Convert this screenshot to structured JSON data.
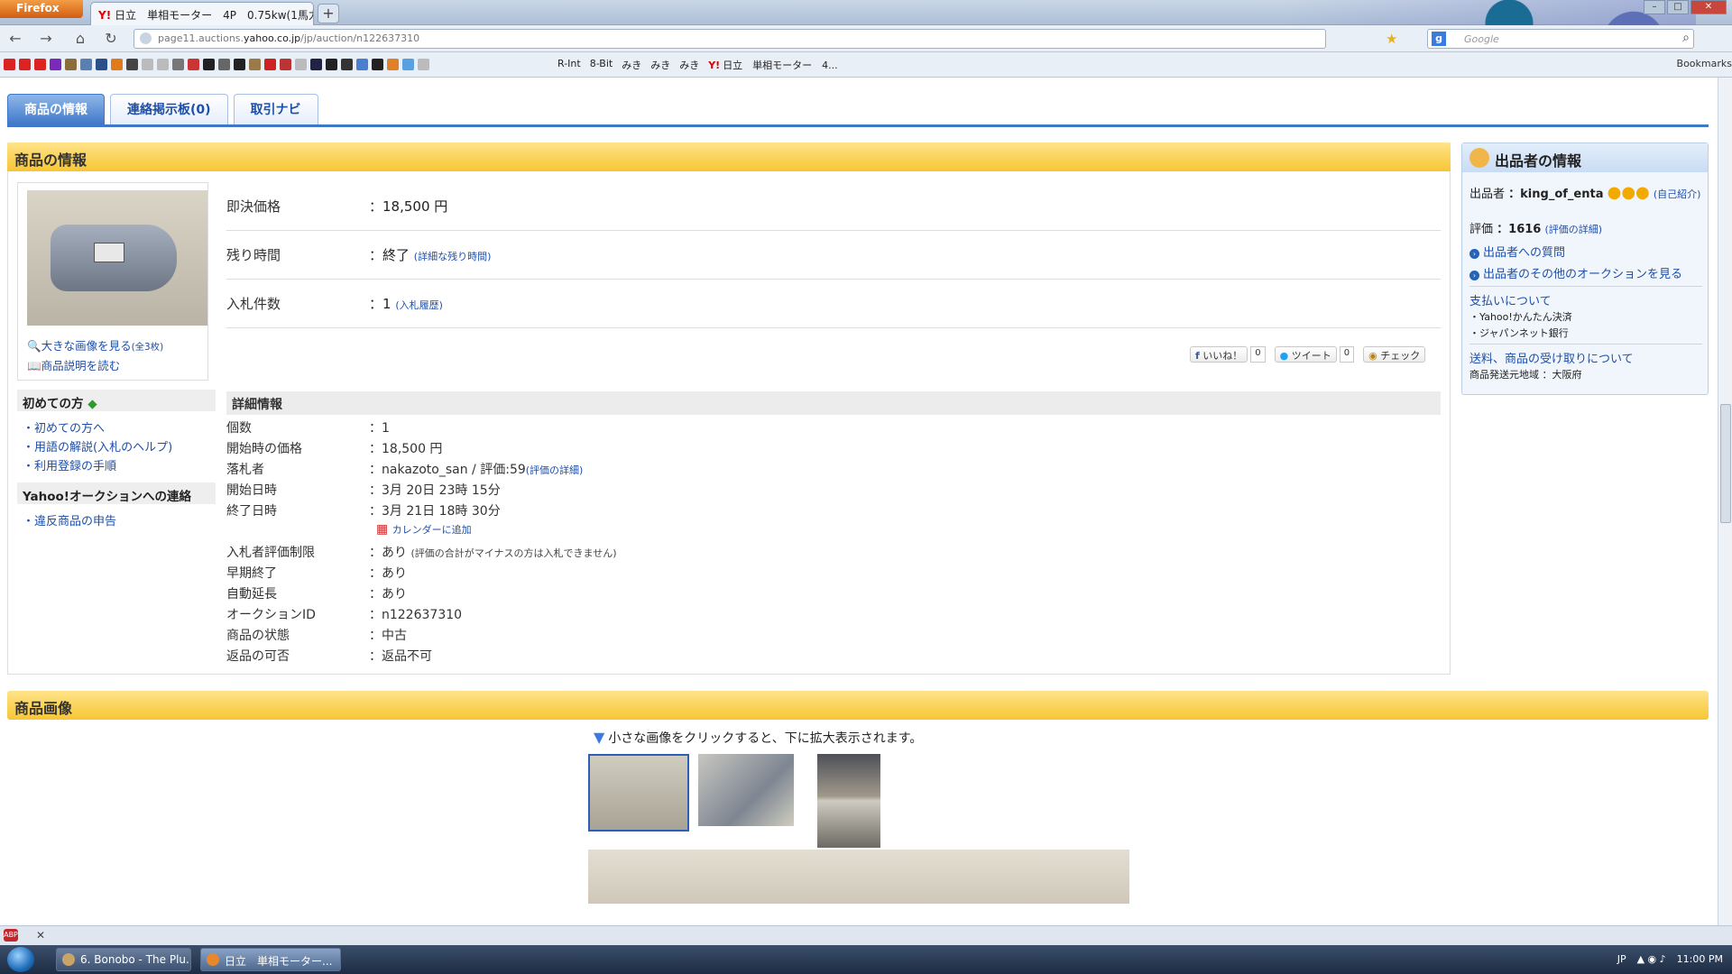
{
  "browser": {
    "menu_label": "Firefox",
    "tab_title": "日立　単相モーター　4P　0.75kw(1馬力)　...",
    "url_prefix": "page11.auctions.",
    "url_domain": "yahoo.co.jp",
    "url_path": "/jp/auction/n122637310",
    "search_placeholder": "Google",
    "bookmarks": [
      "R-Int",
      "8-Bit",
      "みき",
      "みき",
      "みき",
      "日立　単相モーター　4..."
    ],
    "bookmarks_right": "Bookmarks"
  },
  "tabs": [
    "商品の情報",
    "連絡掲示板(0)",
    "取引ナビ"
  ],
  "info_panel": {
    "title": "商品の情報",
    "view_large": "大きな画像を見る",
    "view_large_count": "(全3枚)",
    "read_description": "商品説明を読む"
  },
  "price": {
    "buy_now_label": "即決価格",
    "buy_now_value": "：18,500 円",
    "remaining_label": "残り時間",
    "remaining_value": "：終了",
    "remaining_detail": "(詳細な残り時間)",
    "bids_label": "入札件数",
    "bids_value": "：1",
    "bids_history": "(入札履歴)"
  },
  "social": {
    "like": "いいね！",
    "like_count": "0",
    "tweet": "ツイート",
    "tweet_count": "0",
    "check": "チェック"
  },
  "sidebar_left": {
    "beginner_head": "初めての方",
    "beginner_links": [
      "・初めての方へ",
      "・用語の解説(入札のヘルプ)",
      "・利用登録の手順"
    ],
    "contact_head": "Yahoo!オークションへの連絡",
    "contact_links": [
      "・違反商品の申告"
    ]
  },
  "details": {
    "head": "詳細情報",
    "quantity_label": "個数",
    "quantity_value": "：1",
    "start_price_label": "開始時の価格",
    "start_price_value": "：18,500 円",
    "winner_label": "落札者",
    "winner_value": "：nakazoto_san / 評価:59",
    "winner_link": "(評価の詳細)",
    "start_date_label": "開始日時",
    "start_date_value": "：3月 20日 23時 15分",
    "end_date_label": "終了日時",
    "end_date_value": "：3月 21日 18時 30分",
    "calendar_link": "カレンダーに追加",
    "rating_limit_label": "入札者評価制限",
    "rating_limit_value": "：あり",
    "rating_limit_note": "(評価の合計がマイナスの方は入札できません)",
    "early_end_label": "早期終了",
    "early_end_value": "：あり",
    "auto_extend_label": "自動延長",
    "auto_extend_value": "：あり",
    "auction_id_label": "オークションID",
    "auction_id_value": "：n122637310",
    "condition_label": "商品の状態",
    "condition_value": "：中古",
    "returns_label": "返品の可否",
    "returns_value": "：返品不可"
  },
  "seller": {
    "title": "出品者の情報",
    "seller_label": "出品者",
    "seller_value": "：king_of_enta",
    "self_intro": "(自己紹介)",
    "rating_label": "評価",
    "rating_value": "：1616",
    "rating_detail": "(評価の詳細)",
    "ask_link": "出品者への質問",
    "other_auctions_link": "出品者のその他のオークションを見る",
    "payment_head": "支払いについて",
    "payment_methods": [
      "・Yahoo!かんたん決済",
      "・ジャパンネット銀行"
    ],
    "shipping_link": "送料、商品の受け取りについて",
    "ship_from": "商品発送元地域 ：大阪府"
  },
  "images": {
    "title": "商品画像",
    "hint": "小さな画像をクリックすると、下に拡大表示されます。"
  },
  "taskbar": {
    "buttons": [
      "6. Bonobo - The Plu...",
      "日立　単相モーター..."
    ],
    "lang": "JP",
    "clock": "11:00 PM"
  }
}
